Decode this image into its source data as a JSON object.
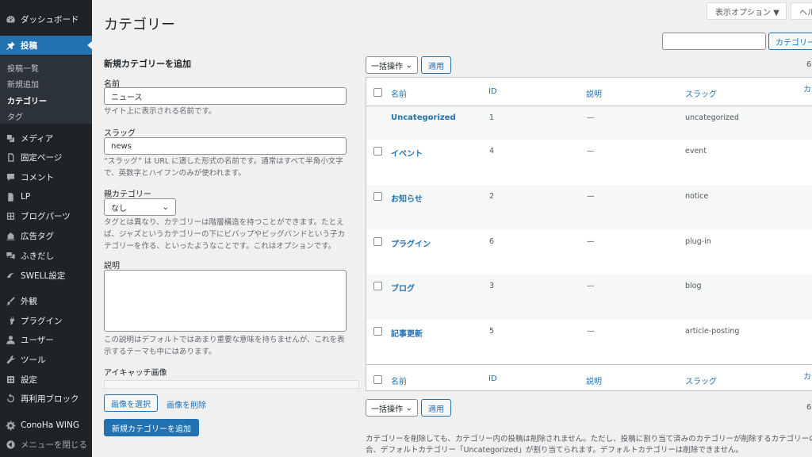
{
  "sidebar": {
    "dashboard": "ダッシュボード",
    "posts": "投稿",
    "posts_sub": [
      "投稿一覧",
      "新規追加",
      "カテゴリー",
      "タグ"
    ],
    "media": "メディア",
    "pages": "固定ページ",
    "comments": "コメント",
    "lp": "LP",
    "blog_parts": "ブログパーツ",
    "ad_tag": "広告タグ",
    "fukidashi": "ふきだし",
    "swell": "SWELL設定",
    "appearance": "外観",
    "plugins": "プラグイン",
    "users": "ユーザー",
    "tools": "ツール",
    "settings": "設定",
    "reusable_blocks": "再利用ブロック",
    "conoha": "ConoHa WING",
    "collapse": "メニューを閉じる"
  },
  "topbar": {
    "screen_options": "表示オプション ▼",
    "help": "ヘル"
  },
  "page_title": "カテゴリー",
  "form": {
    "heading": "新規カテゴリーを追加",
    "name_label": "名前",
    "name_value": "ニュース",
    "name_desc": "サイト上に表示される名前です。",
    "slug_label": "スラッグ",
    "slug_value": "news",
    "slug_desc": "“スラッグ” は URL に適した形式の名前です。通常はすべて半角小文字で、英数字とハイフンのみが使われます。",
    "parent_label": "親カテゴリー",
    "parent_value": "なし",
    "parent_desc": "タグとは異なり、カテゴリーは階層構造を持つことができます。たとえば、ジャズというカテゴリーの下にビバップやビッグバンドという子カテゴリーを作る、といったようなことです。これはオプションです。",
    "description_label": "説明",
    "description_desc": "この説明はデフォルトではあまり重要な意味を持ちませんが、これを表示するテーマも中にはあります。",
    "eyecatch_label": "アイキャッチ画像",
    "select_image": "画像を選択",
    "remove_image": "画像を削除",
    "submit": "新規カテゴリーを追加"
  },
  "list": {
    "search_button": "カテゴリー",
    "bulk_action": "一括操作",
    "apply": "適用",
    "count": "6",
    "columns": {
      "name": "名前",
      "id": "ID",
      "description": "説明",
      "slug": "スラッグ",
      "count": "カ"
    },
    "rows": [
      {
        "name": "Uncategorized",
        "id": "1",
        "description": "—",
        "slug": "uncategorized"
      },
      {
        "name": "イベント",
        "id": "4",
        "description": "—",
        "slug": "event"
      },
      {
        "name": "お知らせ",
        "id": "2",
        "description": "—",
        "slug": "notice"
      },
      {
        "name": "プラグイン",
        "id": "6",
        "description": "—",
        "slug": "plug-in"
      },
      {
        "name": "ブログ",
        "id": "3",
        "description": "—",
        "slug": "blog"
      },
      {
        "name": "記事更新",
        "id": "5",
        "description": "—",
        "slug": "article-posting"
      }
    ],
    "footnote_1": "カテゴリーを削除しても、カテゴリー内の投稿は削除されません。ただし、投稿に割り当て済みのカテゴリーが削除するカテゴリーの",
    "footnote_2": "合、デフォルトカテゴリー「Uncategorized」が割り当てられます。デフォルトカテゴリーは削除できません。"
  }
}
